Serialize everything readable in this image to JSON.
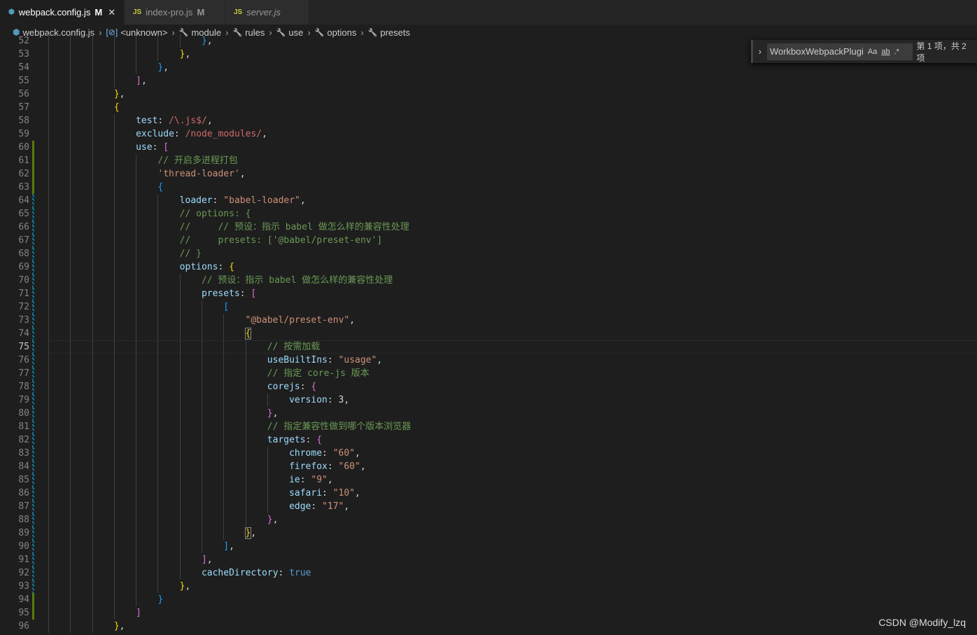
{
  "tabs": [
    {
      "label": "webpack.config.js",
      "badge": "M",
      "icon": "webpack-icon",
      "active": true
    },
    {
      "label": "index-pro.js",
      "badge": "M",
      "icon": "js-icon"
    },
    {
      "label": "server.js",
      "icon": "js-icon"
    }
  ],
  "js_icon_text": "JS",
  "breadcrumb": [
    "webpack.config.js",
    "<unknown>",
    "module",
    "rules",
    "use",
    "options",
    "presets"
  ],
  "find": {
    "value": "WorkboxWebpackPlugi",
    "case": "Aa",
    "word": "ab",
    "regex": ".*",
    "count": "第 1 项，共 2 项"
  },
  "current_line": 75,
  "watermark": "CSDN @Modify_lzq",
  "colors": {
    "key": "#9cdcfe",
    "string": "#ce9178",
    "comment": "#6a9955",
    "bracket1": "#ffd700",
    "bracket2": "#da70d6",
    "bracket3": "#179fff"
  },
  "lines": [
    {
      "n": 52,
      "i": 28,
      "t": [
        [
          "b",
          "}"
        ],
        [
          "w",
          ","
        ]
      ]
    },
    {
      "n": 53,
      "i": 24,
      "t": [
        [
          "g",
          "}"
        ],
        [
          "w",
          ","
        ]
      ]
    },
    {
      "n": 54,
      "i": 20,
      "t": [
        [
          "b",
          "}"
        ],
        [
          "w",
          ","
        ]
      ]
    },
    {
      "n": 55,
      "i": 16,
      "t": [
        [
          "p",
          "]"
        ],
        [
          "w",
          ","
        ]
      ]
    },
    {
      "n": 56,
      "i": 12,
      "t": [
        [
          "g",
          "}"
        ],
        [
          "w",
          ","
        ]
      ]
    },
    {
      "n": 57,
      "i": 12,
      "t": [
        [
          "g",
          "{"
        ]
      ]
    },
    {
      "n": 58,
      "i": 16,
      "t": [
        [
          "k",
          "test"
        ],
        [
          "w",
          ": "
        ],
        [
          "r",
          "/\\.js$/"
        ],
        [
          "w",
          ","
        ]
      ]
    },
    {
      "n": 59,
      "i": 16,
      "t": [
        [
          "k",
          "exclude"
        ],
        [
          "w",
          ": "
        ],
        [
          "r",
          "/node_modules/"
        ],
        [
          "w",
          ","
        ]
      ]
    },
    {
      "n": 60,
      "i": 16,
      "m": "add",
      "t": [
        [
          "k",
          "use"
        ],
        [
          "w",
          ": "
        ],
        [
          "p",
          "["
        ]
      ]
    },
    {
      "n": 61,
      "i": 20,
      "m": "add",
      "t": [
        [
          "c",
          "// 开启多进程打包"
        ]
      ]
    },
    {
      "n": 62,
      "i": 20,
      "m": "add",
      "t": [
        [
          "s",
          "'thread-loader'"
        ],
        [
          "w",
          ","
        ]
      ]
    },
    {
      "n": 63,
      "i": 20,
      "m": "add",
      "t": [
        [
          "b",
          "{"
        ]
      ]
    },
    {
      "n": 64,
      "i": 24,
      "m": "mod",
      "t": [
        [
          "k",
          "loader"
        ],
        [
          "w",
          ": "
        ],
        [
          "s",
          "\"babel-loader\""
        ],
        [
          "w",
          ","
        ]
      ]
    },
    {
      "n": 65,
      "i": 24,
      "m": "mod",
      "t": [
        [
          "c",
          "// options: {"
        ]
      ]
    },
    {
      "n": 66,
      "i": 24,
      "m": "mod",
      "t": [
        [
          "c",
          "//     // 预设：指示 babel 做怎么样的兼容性处理"
        ]
      ]
    },
    {
      "n": 67,
      "i": 24,
      "m": "mod",
      "t": [
        [
          "c",
          "//     presets: ['@babel/preset-env']"
        ]
      ]
    },
    {
      "n": 68,
      "i": 24,
      "m": "mod",
      "t": [
        [
          "c",
          "// }"
        ]
      ]
    },
    {
      "n": 69,
      "i": 24,
      "m": "mod",
      "t": [
        [
          "k",
          "options"
        ],
        [
          "w",
          ": "
        ],
        [
          "g",
          "{"
        ]
      ]
    },
    {
      "n": 70,
      "i": 28,
      "m": "mod",
      "t": [
        [
          "c",
          "// 预设：指示 babel 做怎么样的兼容性处理"
        ]
      ]
    },
    {
      "n": 71,
      "i": 28,
      "m": "mod",
      "t": [
        [
          "k",
          "presets"
        ],
        [
          "w",
          ": "
        ],
        [
          "p",
          "["
        ]
      ]
    },
    {
      "n": 72,
      "i": 32,
      "m": "mod",
      "t": [
        [
          "b",
          "["
        ]
      ]
    },
    {
      "n": 73,
      "i": 36,
      "m": "mod",
      "t": [
        [
          "s",
          "\"@babel/preset-env\""
        ],
        [
          "w",
          ","
        ]
      ]
    },
    {
      "n": 74,
      "i": 36,
      "m": "mod",
      "t": [
        [
          "g box",
          "{"
        ]
      ]
    },
    {
      "n": 75,
      "i": 40,
      "m": "mod",
      "t": [
        [
          "c",
          "// 按需加载"
        ]
      ]
    },
    {
      "n": 76,
      "i": 40,
      "m": "mod",
      "t": [
        [
          "k",
          "useBuiltIns"
        ],
        [
          "w",
          ": "
        ],
        [
          "s",
          "\"usage\""
        ],
        [
          "w",
          ","
        ]
      ]
    },
    {
      "n": 77,
      "i": 40,
      "m": "mod",
      "t": [
        [
          "c",
          "// 指定 core-js 版本"
        ]
      ]
    },
    {
      "n": 78,
      "i": 40,
      "m": "mod",
      "t": [
        [
          "k",
          "corejs"
        ],
        [
          "w",
          ": "
        ],
        [
          "p",
          "{"
        ]
      ]
    },
    {
      "n": 79,
      "i": 44,
      "m": "mod",
      "t": [
        [
          "k",
          "version"
        ],
        [
          "w",
          ": "
        ],
        [
          "w",
          "3"
        ],
        [
          "w",
          ","
        ]
      ]
    },
    {
      "n": 80,
      "i": 40,
      "m": "mod",
      "t": [
        [
          "p",
          "}"
        ],
        [
          "w",
          ","
        ]
      ]
    },
    {
      "n": 81,
      "i": 40,
      "m": "mod",
      "t": [
        [
          "c",
          "// 指定兼容性做到哪个版本浏览器"
        ]
      ]
    },
    {
      "n": 82,
      "i": 40,
      "m": "mod",
      "t": [
        [
          "k",
          "targets"
        ],
        [
          "w",
          ": "
        ],
        [
          "p",
          "{"
        ]
      ]
    },
    {
      "n": 83,
      "i": 44,
      "m": "mod",
      "t": [
        [
          "k",
          "chrome"
        ],
        [
          "w",
          ": "
        ],
        [
          "s",
          "\"60\""
        ],
        [
          "w",
          ","
        ]
      ]
    },
    {
      "n": 84,
      "i": 44,
      "m": "mod",
      "t": [
        [
          "k",
          "firefox"
        ],
        [
          "w",
          ": "
        ],
        [
          "s",
          "\"60\""
        ],
        [
          "w",
          ","
        ]
      ]
    },
    {
      "n": 85,
      "i": 44,
      "m": "mod",
      "t": [
        [
          "k",
          "ie"
        ],
        [
          "w",
          ": "
        ],
        [
          "s",
          "\"9\""
        ],
        [
          "w",
          ","
        ]
      ]
    },
    {
      "n": 86,
      "i": 44,
      "m": "mod",
      "t": [
        [
          "k",
          "safari"
        ],
        [
          "w",
          ": "
        ],
        [
          "s",
          "\"10\""
        ],
        [
          "w",
          ","
        ]
      ]
    },
    {
      "n": 87,
      "i": 44,
      "m": "mod",
      "t": [
        [
          "k",
          "edge"
        ],
        [
          "w",
          ": "
        ],
        [
          "s",
          "\"17\""
        ],
        [
          "w",
          ","
        ]
      ]
    },
    {
      "n": 88,
      "i": 40,
      "m": "mod",
      "t": [
        [
          "p",
          "}"
        ],
        [
          "w",
          ","
        ]
      ]
    },
    {
      "n": 89,
      "i": 36,
      "m": "mod",
      "t": [
        [
          "g box",
          "}"
        ],
        [
          "w",
          ","
        ]
      ]
    },
    {
      "n": 90,
      "i": 32,
      "m": "mod",
      "t": [
        [
          "b",
          "]"
        ],
        [
          "w",
          ","
        ]
      ]
    },
    {
      "n": 91,
      "i": 28,
      "m": "mod",
      "t": [
        [
          "p",
          "]"
        ],
        [
          "w",
          ","
        ]
      ]
    },
    {
      "n": 92,
      "i": 28,
      "m": "mod",
      "t": [
        [
          "k",
          "cacheDirectory"
        ],
        [
          "w",
          ": "
        ],
        [
          "t",
          "true"
        ]
      ]
    },
    {
      "n": 93,
      "i": 24,
      "m": "mod",
      "t": [
        [
          "g",
          "}"
        ],
        [
          "w",
          ","
        ]
      ]
    },
    {
      "n": 94,
      "i": 20,
      "m": "add",
      "t": [
        [
          "b",
          "}"
        ]
      ]
    },
    {
      "n": 95,
      "i": 16,
      "m": "add",
      "t": [
        [
          "p",
          "]"
        ]
      ]
    },
    {
      "n": 96,
      "i": 12,
      "t": [
        [
          "g",
          "}"
        ],
        [
          "w",
          ","
        ]
      ]
    }
  ]
}
